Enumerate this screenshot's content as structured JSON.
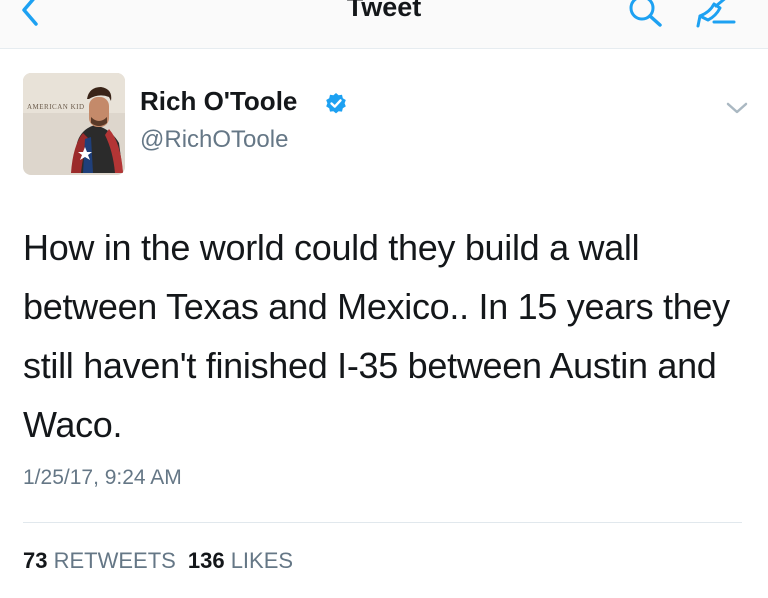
{
  "navbar": {
    "title": "Tweet",
    "back_icon": "chevron-left-icon",
    "search_icon": "search-icon",
    "compose_icon": "compose-icon"
  },
  "tweet": {
    "author": {
      "display_name": "Rich O'Toole",
      "handle": "@RichOToole",
      "verified": true,
      "avatar_caption": "AMERICAN KID"
    },
    "text": "How in the world could they build a wall between Texas and Mexico.. In 15 years they still haven't finished I-35 between Austin and Waco.",
    "timestamp": "1/25/17, 9:24 AM",
    "stats": {
      "retweets_count": "73",
      "retweets_label": "RETWEETS",
      "likes_count": "136",
      "likes_label": "LIKES"
    }
  },
  "colors": {
    "accent": "#1da1f2",
    "primary_text": "#14171a",
    "secondary_text": "#657786",
    "divider": "#e1e8ed"
  }
}
